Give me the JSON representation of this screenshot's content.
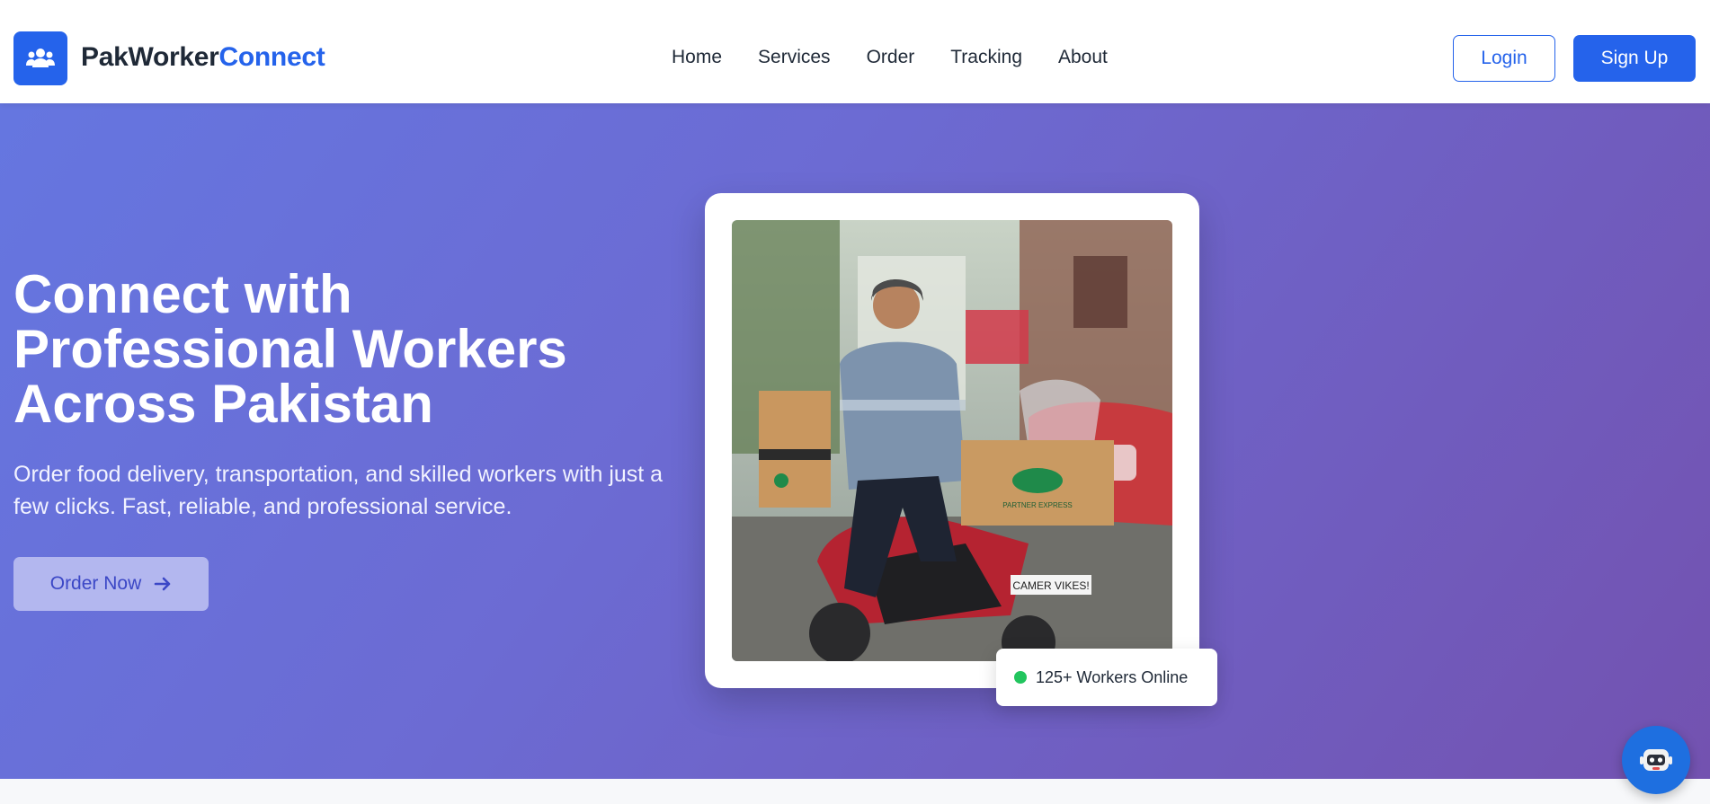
{
  "header": {
    "brand_main": "PakWorker",
    "brand_accent": "Connect",
    "nav": [
      "Home",
      "Services",
      "Order",
      "Tracking",
      "About"
    ],
    "login_label": "Login",
    "signup_label": "Sign Up"
  },
  "hero": {
    "title_line1": "Connect with",
    "title_line2": "Professional Workers",
    "title_line3": "Across Pakistan",
    "subtitle": "Order food delivery, transportation, and skilled workers with just a few clicks. Fast, reliable, and professional service.",
    "cta_label": "Order Now",
    "badge_text": "125+ Workers Online",
    "photo_box_label": "PARTNER EXPRESS",
    "plate_text": "CAMER VIKES!"
  },
  "colors": {
    "accent": "#2563eb",
    "hero_start": "#6576e0",
    "hero_end": "#7352b0",
    "online": "#22c55e"
  },
  "icons": {
    "logo": "users-icon",
    "cta": "arrow-right-icon",
    "chat": "robot-icon"
  }
}
